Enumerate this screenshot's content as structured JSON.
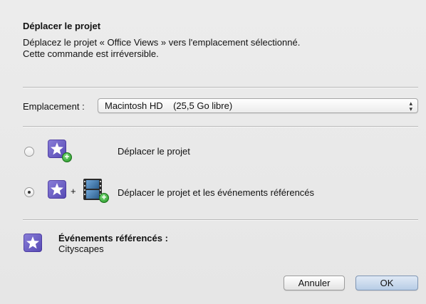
{
  "dialog": {
    "title": "Déplacer le projet",
    "description_line1": "Déplacez le projet « Office Views » vers l'emplacement sélectionné.",
    "description_line2": "Cette commande est irréversible."
  },
  "location": {
    "label": "Emplacement :",
    "selected_value": "Macintosh HD    (25,5 Go libre)"
  },
  "options": [
    {
      "label": "Déplacer le projet",
      "selected": false
    },
    {
      "label": "Déplacer le projet et les événements référencés",
      "selected": true
    }
  ],
  "plus_sign": "+",
  "events": {
    "title": "Événements référencés :",
    "value": "Cityscapes"
  },
  "buttons": {
    "cancel": "Annuler",
    "ok": "OK"
  },
  "colors": {
    "accent": "#5548b3",
    "badge_green": "#1e8f1e",
    "default_button": "#b8cde6"
  }
}
